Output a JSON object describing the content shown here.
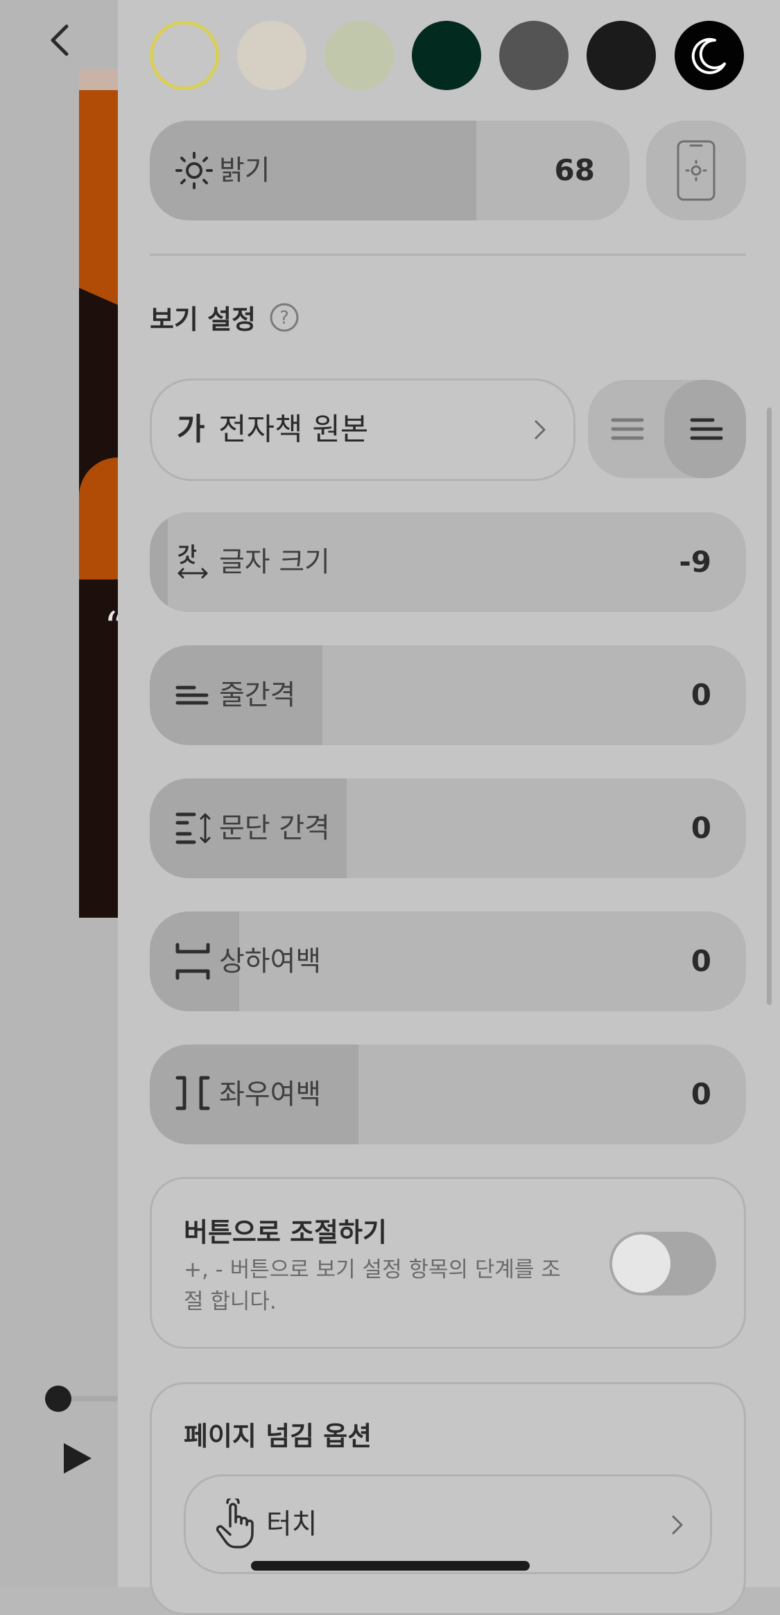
{
  "reader": {
    "back_icon": "chevron-left-icon",
    "quote_mark": "“",
    "progress": 0.0,
    "play_icon": "play-icon"
  },
  "theme": {
    "swatches": [
      {
        "name": "white",
        "color": "#c6c6c6",
        "selected": true,
        "ring": "#d9cf57"
      },
      {
        "name": "cream",
        "color": "#d6cfc3"
      },
      {
        "name": "sage",
        "color": "#c1c7aa"
      },
      {
        "name": "dark-green",
        "color": "#032a1e"
      },
      {
        "name": "gray",
        "color": "#545454"
      },
      {
        "name": "charcoal",
        "color": "#1b1b1b"
      },
      {
        "name": "night",
        "color": "#020202",
        "icon": "moon-icon"
      }
    ]
  },
  "brightness": {
    "label": "밝기",
    "value": "68",
    "level": 0.68,
    "icon": "sun-icon",
    "system_icon": "phone-brightness-icon"
  },
  "view_settings": {
    "title": "보기 설정",
    "help_icon": "question-circle-icon",
    "font": {
      "prefix": "가",
      "name": "전자책 원본",
      "chevron_icon": "chevron-right-icon"
    },
    "alignment": {
      "options": [
        "justify-icon",
        "align-left-icon"
      ],
      "selected": "align-left-icon"
    },
    "rows": [
      {
        "key": "font_size",
        "label": "글자 크기",
        "value": "-9",
        "level": 0.03,
        "icon": "font-size-icon"
      },
      {
        "key": "line_spacing",
        "label": "줄간격",
        "value": "0",
        "level": 0.29,
        "icon": "line-spacing-icon"
      },
      {
        "key": "paragraph_spacing",
        "label": "문단 간격",
        "value": "0",
        "level": 0.33,
        "icon": "paragraph-spacing-icon"
      },
      {
        "key": "vertical_margin",
        "label": "상하여백",
        "value": "0",
        "level": 0.15,
        "icon": "vertical-margin-icon"
      },
      {
        "key": "horizontal_margin",
        "label": "좌우여백",
        "value": "0",
        "level": 0.35,
        "icon": "horizontal-margin-icon"
      }
    ]
  },
  "button_control": {
    "title": "버튼으로 조절하기",
    "desc": "+, - 버튼으로 보기 설정 항목의 단계를 조절 합니다.",
    "enabled": false
  },
  "page_turn": {
    "title": "페이지 넘김 옵션",
    "option_label": "터치",
    "icon": "touch-hand-icon",
    "chevron_icon": "chevron-right-icon"
  },
  "colors": {
    "panel": "#c5c5c5",
    "pill": "#b6b6b6",
    "pill_fill": "#a7a7a7",
    "text": "#2b2b2b"
  }
}
